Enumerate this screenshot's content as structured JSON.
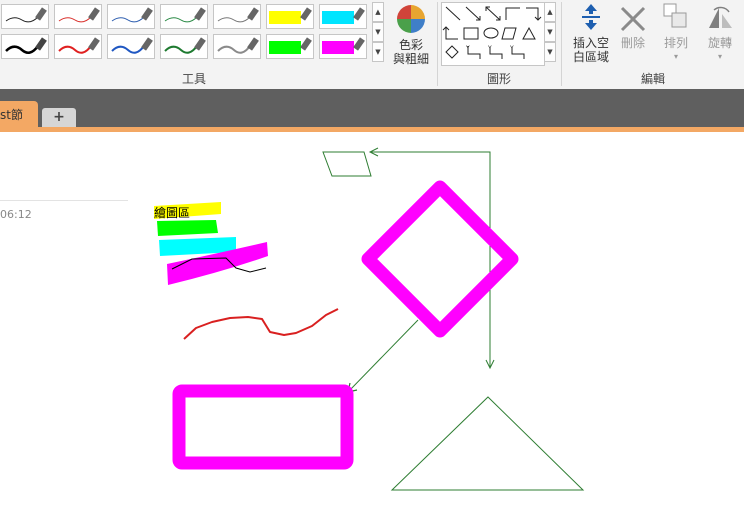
{
  "ribbon": {
    "groups": {
      "tools": "工具",
      "shapes": "圖形",
      "edit": "編輯"
    },
    "color_thickness": {
      "label_line1": "色彩",
      "label_line2": "與粗細"
    },
    "insert_space": {
      "label_line1": "插入空",
      "label_line2": "白區域"
    },
    "delete_label": "刪除",
    "arrange_label": "排列",
    "rotate_label": "旋轉",
    "pen_colors_row1": [
      "#222222",
      "#d9302c",
      "#2f5fb0",
      "#2a8a45",
      "#777777",
      "#ffff00",
      "#00e5ff"
    ],
    "pen_colors_row2": [
      "#000000",
      "#e02020",
      "#1f57c2",
      "#1e7a30",
      "#8a8a8a",
      "#00ff00",
      "#ff00ff"
    ],
    "colors": {
      "accent": "#1e5fb0",
      "delete": "#8a8a8a"
    }
  },
  "tabs": {
    "active_label": "st節",
    "add_label": "+"
  },
  "page": {
    "time": "06:12",
    "highlight_label": "繪圖區"
  },
  "colors": {
    "tab_bar": "#5f5f5f",
    "section_orange": "#f3a864",
    "magenta": "#ff00ff",
    "shape_green": "#2e7d32",
    "ink_red": "#d92020"
  }
}
